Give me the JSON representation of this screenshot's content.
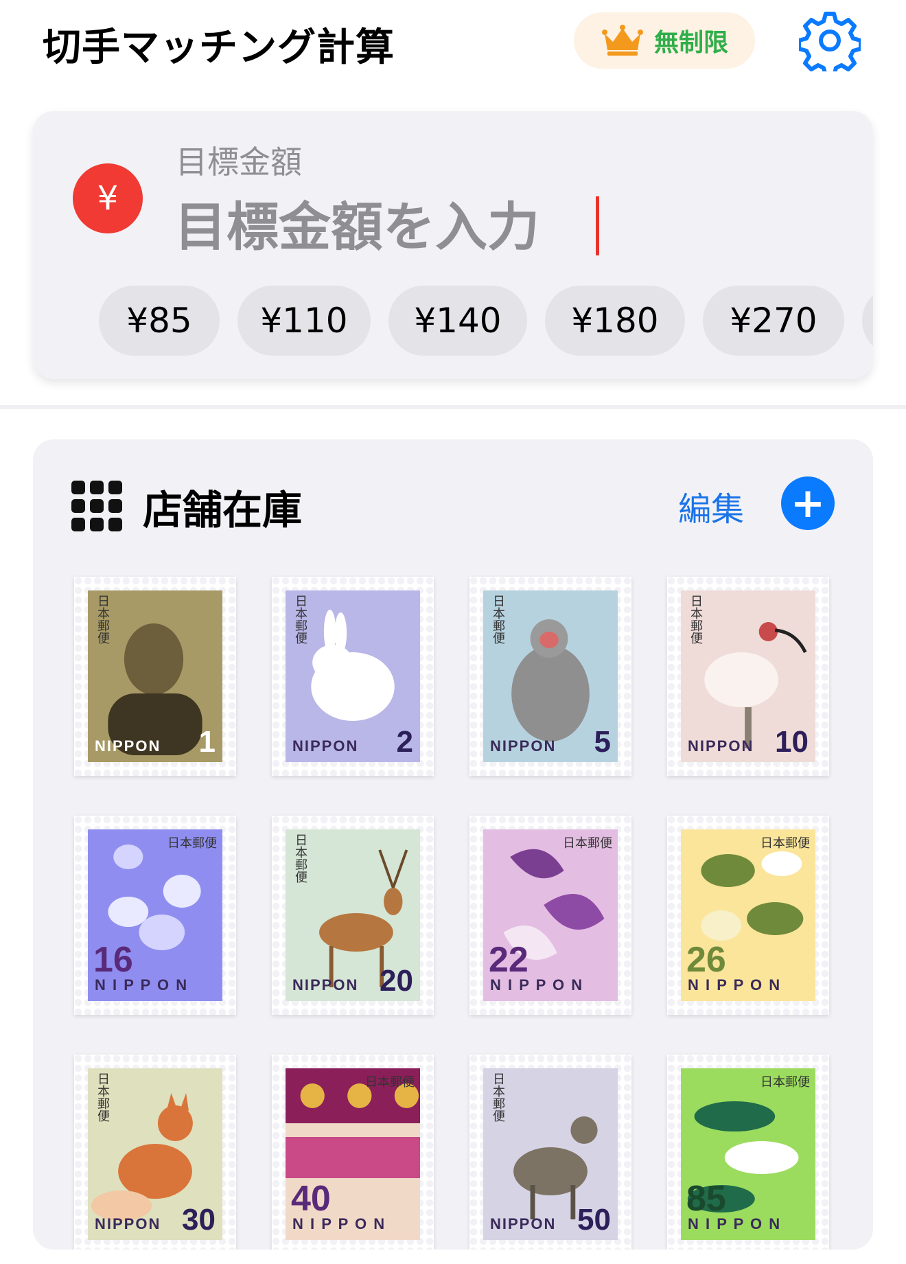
{
  "header": {
    "title": "切手マッチング計算",
    "plan_badge": "無制限"
  },
  "target": {
    "label": "目標金額",
    "placeholder": "目標金額を入力",
    "currency_symbol": "¥"
  },
  "quick_amounts": [
    "¥85",
    "¥110",
    "¥140",
    "¥180",
    "¥270"
  ],
  "inventory": {
    "title": "店舗在庫",
    "edit_label": "編集",
    "add_symbol": "+"
  },
  "stamps": [
    {
      "value": "1",
      "nippon": "NIPPON",
      "subject": "portrait",
      "bg": "#a89a66"
    },
    {
      "value": "2",
      "nippon": "NIPPON",
      "subject": "hare",
      "bg": "#b9b6e8"
    },
    {
      "value": "5",
      "nippon": "NIPPON",
      "subject": "macaque",
      "bg": "#b7d2df"
    },
    {
      "value": "10",
      "nippon": "NIPPON",
      "subject": "ibis",
      "bg": "#efdcd8"
    },
    {
      "value": "16",
      "nippon": "N I P P O N",
      "subject": "shells",
      "bg": "#8f8ef0"
    },
    {
      "value": "20",
      "nippon": "NIPPON",
      "subject": "deer",
      "bg": "#d5e5d6"
    },
    {
      "value": "22",
      "nippon": "N I P P O N",
      "subject": "leaves",
      "bg": "#e3bde2"
    },
    {
      "value": "26",
      "nippon": "N I P P O N",
      "subject": "birds",
      "bg": "#fbe59a"
    },
    {
      "value": "30",
      "nippon": "NIPPON",
      "subject": "fox",
      "bg": "#dfe0bd"
    },
    {
      "value": "40",
      "nippon": "N I P P O N",
      "subject": "pattern",
      "bg": "#f1d9c7"
    },
    {
      "value": "50",
      "nippon": "NIPPON",
      "subject": "serow",
      "bg": "#d6d3e5"
    },
    {
      "value": "85",
      "nippon": "N I P P O N",
      "subject": "pine",
      "bg": "#9bdc5f"
    }
  ],
  "japan_post": "日本郵便",
  "colors": {
    "accent_blue": "#0a7aff",
    "yen_red": "#f03a33",
    "plan_green": "#2fae4a",
    "crown_orange": "#f39a1e"
  }
}
